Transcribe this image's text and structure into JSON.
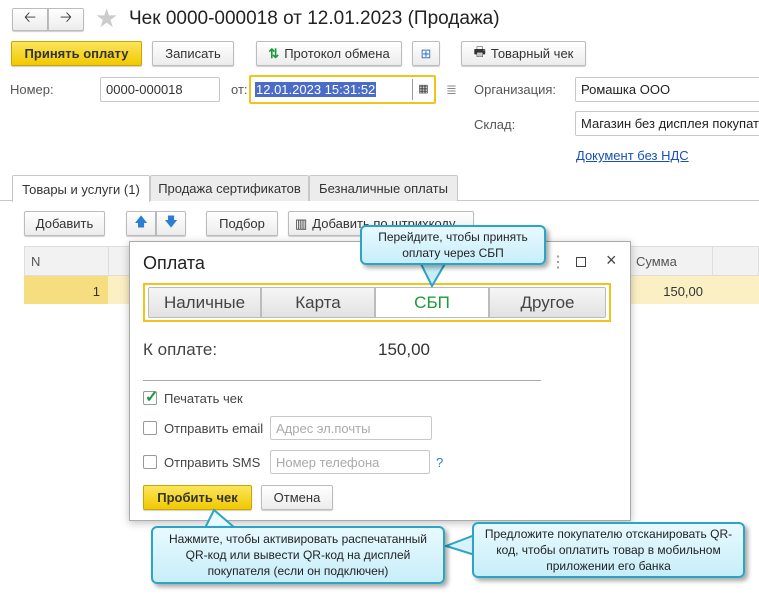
{
  "header": {
    "title": "Чек 0000-000018 от 12.01.2023 (Продажа)"
  },
  "toolbar": {
    "accept_payment": "Принять оплату",
    "save": "Записать",
    "exchange_log": "Протокол обмена",
    "sales_receipt": "Товарный чек"
  },
  "form": {
    "number_label": "Номер:",
    "number_value": "0000-000018",
    "date_label": "от:",
    "date_value": "12.01.2023 15:31:52",
    "org_label": "Организация:",
    "org_value": "Ромашка ООО",
    "warehouse_label": "Склад:",
    "warehouse_value": "Магазин без дисплея покупателя",
    "vat_link": "Документ без НДС"
  },
  "tabs": [
    {
      "label": "Товары и услуги (1)",
      "active": true
    },
    {
      "label": "Продажа сертификатов"
    },
    {
      "label": "Безналичные оплаты"
    }
  ],
  "table_toolbar": {
    "add": "Добавить",
    "pick": "Подбор",
    "add_barcode": "Добавить по штрихкоду"
  },
  "table": {
    "columns": [
      "N",
      "Сумма"
    ],
    "rows": [
      {
        "n": "1",
        "sum": "150,00"
      }
    ]
  },
  "dialog": {
    "title": "Оплата",
    "segments": [
      "Наличные",
      "Карта",
      "СБП",
      "Другое"
    ],
    "selected_segment": "СБП",
    "to_pay_label": "К оплате:",
    "to_pay_value": "150,00",
    "print_receipt": {
      "label": "Печатать чек",
      "checked": true
    },
    "send_email": {
      "label": "Отправить email",
      "checked": false,
      "placeholder": "Адрес эл.почты"
    },
    "send_sms": {
      "label": "Отправить SMS",
      "checked": false,
      "placeholder": "Номер телефона"
    },
    "help": "?",
    "submit": "Пробить чек",
    "cancel": "Отмена"
  },
  "callouts": {
    "sbp": "Перейдите, чтобы принять оплату через СБП",
    "submit": "Нажмите, чтобы активировать распечатанный QR-код или вывести QR-код на дисплей покупателя (если он подключен)",
    "scan": "Предложите покупателю отсканировать QR-код, чтобы оплатить товар в мобильном приложении его банка"
  },
  "colors": {
    "accent_yellow": "#f5d217",
    "sbp_green": "#1a9a3a",
    "callout_border": "#2aa5c6",
    "link": "#1a4fb5"
  }
}
